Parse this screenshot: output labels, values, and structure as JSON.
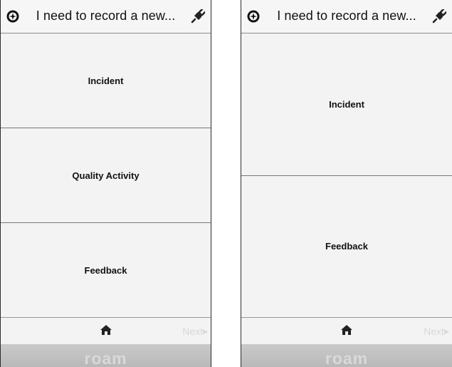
{
  "screens": [
    {
      "title": "I need to record a new...",
      "options": [
        "Incident",
        "Quality Activity",
        "Feedback"
      ],
      "next_label": "Next",
      "brand": "roam"
    },
    {
      "title": "I need to record a new...",
      "options": [
        "Incident",
        "Feedback"
      ],
      "next_label": "Next",
      "brand": "roam"
    }
  ],
  "icons": {
    "left_header": "compass-icon",
    "right_header": "plug-icon",
    "footer": "home-icon",
    "next": "chevron-right-icon"
  }
}
